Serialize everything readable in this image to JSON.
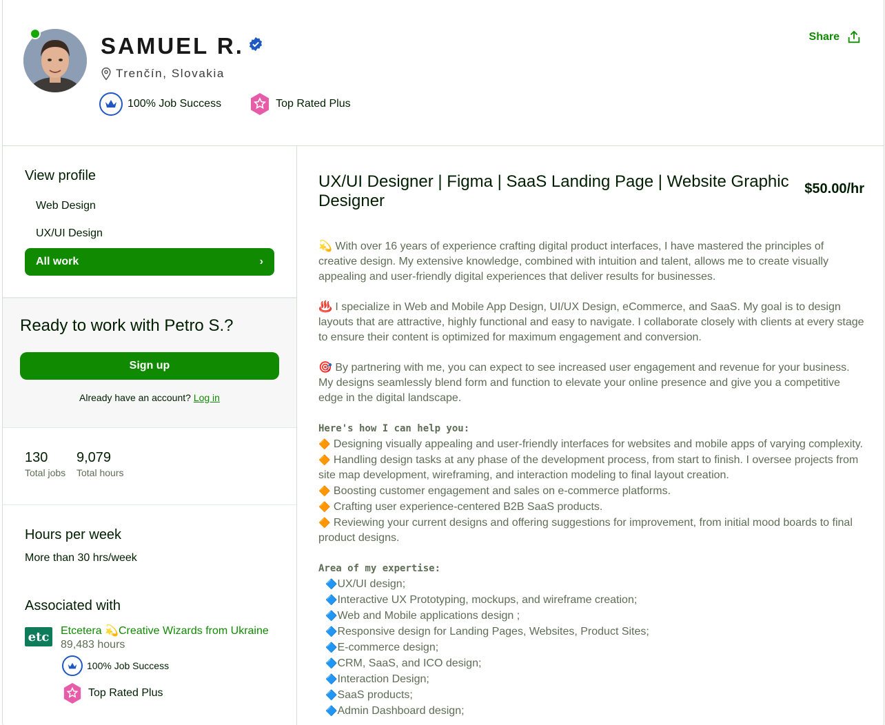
{
  "profile": {
    "name": "SAMUEL R.",
    "location": "Trenčín, Slovakia",
    "job_success": "100% Job Success",
    "top_rated": "Top Rated Plus",
    "share_label": "Share"
  },
  "sidebar": {
    "view_profile_title": "View profile",
    "items": [
      {
        "label": "Web Design"
      },
      {
        "label": "UX/UI Design"
      },
      {
        "label": "All work",
        "chevron": "›"
      }
    ],
    "ready_title": "Ready to work with Petro S.?",
    "signup_label": "Sign up",
    "have_account": "Already have an account?",
    "login_label": "Log in",
    "stats": [
      {
        "value": "130",
        "label": "Total jobs"
      },
      {
        "value": "9,079",
        "label": "Total hours"
      }
    ],
    "hours_title": "Hours per week",
    "hours_value": "More than 30 hrs/week",
    "assoc_title": "Associated with",
    "agency": {
      "logo_text": "etc",
      "name": "Etcetera 💫Creative Wizards from Ukraine",
      "hours": "89,483 hours",
      "job_success": "100% Job Success",
      "top_rated": "Top Rated Plus"
    }
  },
  "main": {
    "title": "UX/UI Designer | Figma | SaaS Landing Page | Website Graphic Designer",
    "rate": "$50.00/hr",
    "para1": "💫 With over 16 years of experience crafting digital product interfaces, I have mastered the principles of creative design. My extensive knowledge, combined with intuition and talent, allows me to create visually appealing and user-friendly digital experiences that deliver results for businesses.",
    "para2": "♨️ I specialize in Web and Mobile App Design, UI/UX Design, eCommerce, and SaaS. My goal is to design layouts that are attractive, highly functional and easy to navigate. I collaborate closely with clients at every stage to ensure their content is optimized for maximum engagement and conversion.",
    "para3": "🎯 By partnering with me, you can expect to see increased user engagement and revenue for your business. My designs seamlessly blend form and function to elevate your online presence and give you a competitive edge in the digital landscape.",
    "help_heading": "Here's how I can help you:",
    "help_items": [
      "Designing visually appealing and user-friendly interfaces for websites and mobile apps of varying complexity.",
      "Handling design tasks at any phase of the development process, from start to finish. I oversee projects from site map development, wireframing, and interaction modeling to final layout creation.",
      "Boosting customer engagement and sales on e-commerce platforms.",
      "Crafting user experience-centered B2B SaaS products.",
      "Reviewing your current designs and offering suggestions for improvement, from initial mood boards to final product designs."
    ],
    "expertise_heading": "Area of my expertise:",
    "expertise_items": [
      "UX/UI design;",
      "Interactive UX Prototyping, mockups, and wireframe creation;",
      "Web and Mobile applications design ;",
      "Responsive design for Landing Pages, Websites, Product Sites;",
      "E-commerce design;",
      "CRM, SaaS, and ICO design;",
      "Interaction Design;",
      "SaaS products;",
      "Admin Dashboard design;"
    ],
    "bullet_orange": "🔶",
    "bullet_blue": "🔷"
  },
  "colors": {
    "brand_green": "#108a00",
    "badge_blue": "#1f57c3",
    "top_rated_pink": "#e65ca8"
  }
}
